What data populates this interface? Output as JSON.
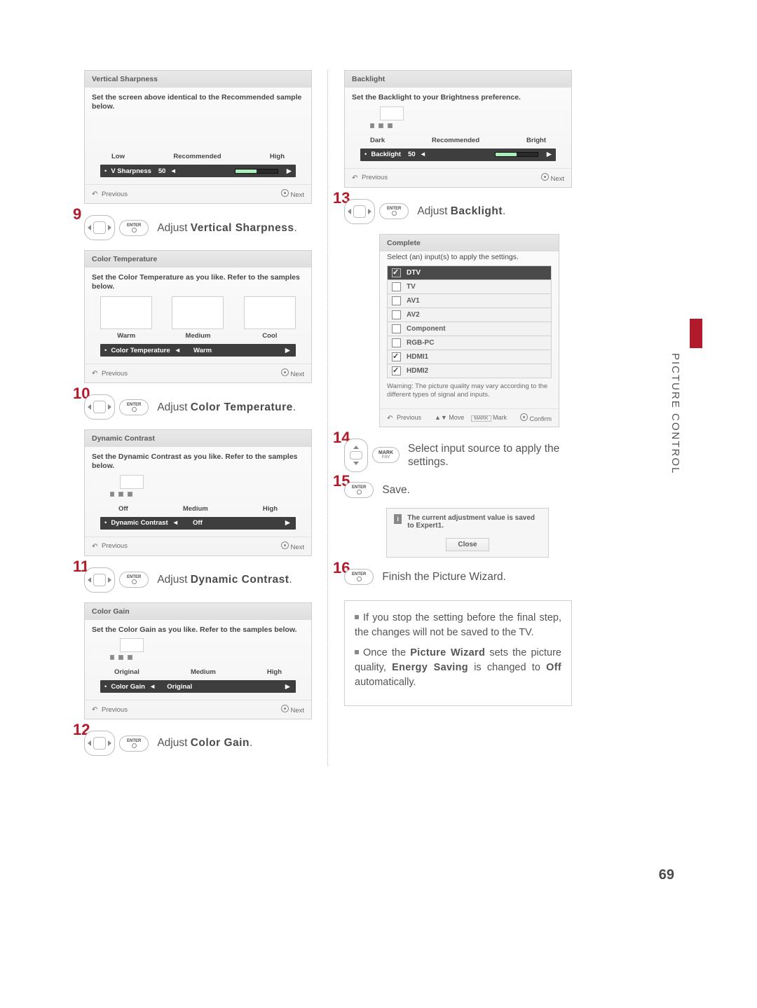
{
  "side_label": "PICTURE CONTROL",
  "page_number": "69",
  "common": {
    "prev": "Previous",
    "next": "Next",
    "move": "Move",
    "mark_btn": "MARK",
    "mark": "Mark",
    "confirm": "Confirm"
  },
  "panels": {
    "vsharp": {
      "title": "Vertical Sharpness",
      "instr": "Set the screen above identical to the Recommended sample below.",
      "labels": [
        "Low",
        "Recommended",
        "High"
      ],
      "bar_name": "V Sharpness",
      "bar_val": "50"
    },
    "ctemp": {
      "title": "Color Temperature",
      "instr": "Set the Color Temperature as you like. Refer to the samples below.",
      "labels": [
        "Warm",
        "Medium",
        "Cool"
      ],
      "bar_name": "Color Temperature",
      "bar_val": "Warm"
    },
    "dcon": {
      "title": "Dynamic Contrast",
      "instr": "Set the Dynamic Contrast as you like. Refer to the samples below.",
      "labels": [
        "Off",
        "Medium",
        "High"
      ],
      "bar_name": "Dynamic Contrast",
      "bar_val": "Off"
    },
    "cgain": {
      "title": "Color Gain",
      "instr": "Set the Color Gain as you like. Refer to the samples below.",
      "labels": [
        "Original",
        "Medium",
        "High"
      ],
      "bar_name": "Color Gain",
      "bar_val": "Original"
    },
    "blight": {
      "title": "Backlight",
      "instr": "Set the Backlight to your Brightness preference.",
      "labels": [
        "Dark",
        "Recommended",
        "Bright"
      ],
      "bar_name": "Backlight",
      "bar_val": "50"
    },
    "complete": {
      "title": "Complete",
      "instr": "Select (an) input(s) to apply the settings.",
      "items": [
        {
          "label": "DTV",
          "checked": true,
          "selected": true
        },
        {
          "label": "TV",
          "checked": false
        },
        {
          "label": "AV1",
          "checked": false
        },
        {
          "label": "AV2",
          "checked": false
        },
        {
          "label": "Component",
          "checked": false
        },
        {
          "label": "RGB-PC",
          "checked": false
        },
        {
          "label": "HDMI1",
          "checked": true
        },
        {
          "label": "HDMI2",
          "checked": true
        }
      ],
      "warn": "Warning: The picture quality may vary according to the different types of signal and inputs."
    },
    "saved": {
      "msg": "The current adjustment value is saved to Expert1.",
      "close": "Close"
    }
  },
  "steps": {
    "s9": {
      "num": "9",
      "enter": "ENTER",
      "t1": "Adjust ",
      "b": "Vertical Sharpness",
      "t2": "."
    },
    "s10": {
      "num": "10",
      "enter": "ENTER",
      "t1": "Adjust ",
      "b": "Color Temperature",
      "t2": "."
    },
    "s11": {
      "num": "11",
      "enter": "ENTER",
      "t1": "Adjust ",
      "b": "Dynamic Contrast",
      "t2": "."
    },
    "s12": {
      "num": "12",
      "enter": "ENTER",
      "t1": "Adjust ",
      "b": "Color Gain",
      "t2": "."
    },
    "s13": {
      "num": "13",
      "enter": "ENTER",
      "t1": "Adjust ",
      "b": "Backlight",
      "t2": "."
    },
    "s14": {
      "num": "14",
      "btn_top": "MARK",
      "btn_sub": "FAV",
      "t1": "Select input source to apply the settings."
    },
    "s15": {
      "num": "15",
      "enter": "ENTER",
      "t1": "Save."
    },
    "s16": {
      "num": "16",
      "enter": "ENTER",
      "t1": "Finish the Picture Wizard."
    }
  },
  "notes": {
    "n1a": "If you stop the setting before the final step, the changes will not be saved to the TV.",
    "n2a": "Once the ",
    "n2b": "Picture Wizard",
    "n2c": " sets the picture quality, ",
    "n2d": "Energy Saving",
    "n2e": " is changed to ",
    "n2f": "Off",
    "n2g": " automatically."
  }
}
